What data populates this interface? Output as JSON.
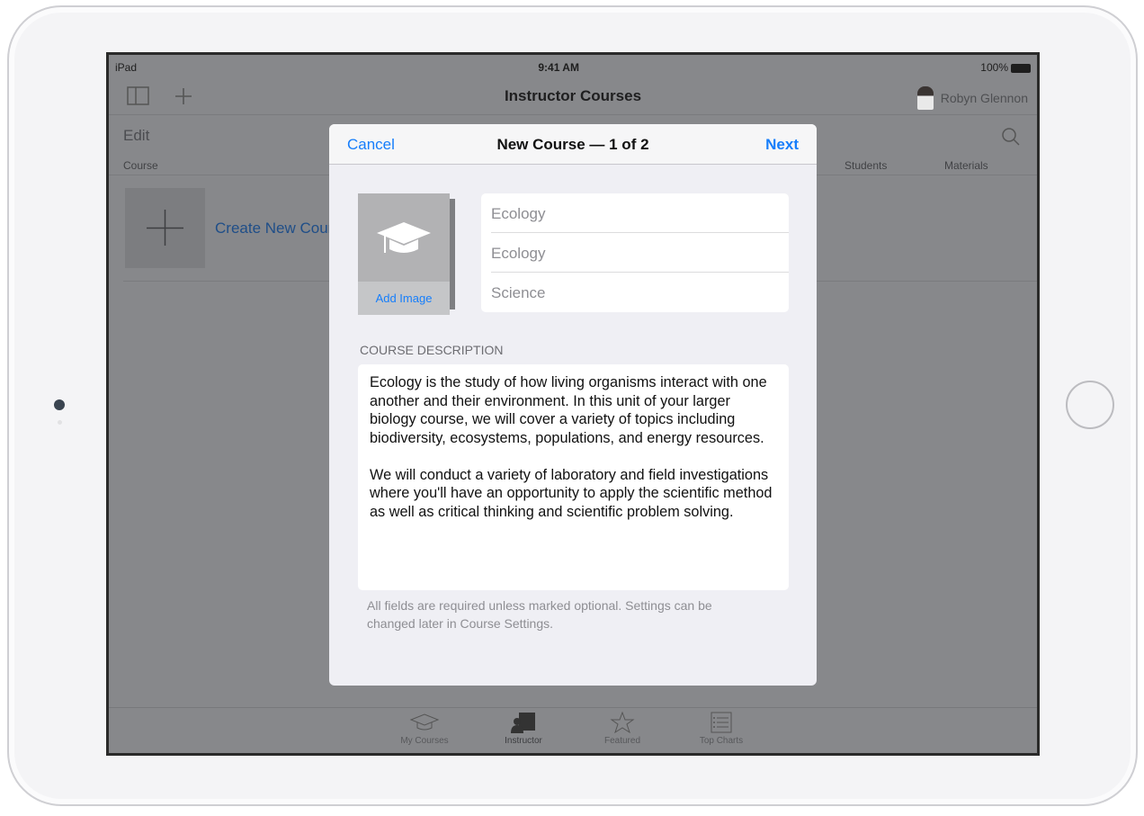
{
  "status": {
    "device": "iPad",
    "time": "9:41 AM",
    "battery": "100%"
  },
  "navbar": {
    "title": "Instructor Courses",
    "user": "Robyn Glennon"
  },
  "list": {
    "edit": "Edit",
    "col_course": "Course",
    "col_students": "Students",
    "col_materials": "Materials",
    "create": "Create New Course"
  },
  "tabs": [
    {
      "label": "My Courses",
      "icon": "graduation-cap-icon"
    },
    {
      "label": "Instructor",
      "icon": "instructor-icon"
    },
    {
      "label": "Featured",
      "icon": "star-icon"
    },
    {
      "label": "Top Charts",
      "icon": "list-icon"
    }
  ],
  "modal": {
    "cancel": "Cancel",
    "title": "New Course — 1 of 2",
    "next": "Next",
    "add_image": "Add Image",
    "fields": [
      "Ecology",
      "Ecology",
      "Science"
    ],
    "description_label": "COURSE DESCRIPTION",
    "description": [
      "Ecology is the study of how living organisms interact with one another and their environment. In this unit of your larger biology course, we will cover a variety of topics including biodiversity, ecosystems, populations, and energy resources.",
      "We will conduct a variety of laboratory and field investigations where you'll have an opportunity to apply the scientific method as well as critical thinking and scientific problem solving."
    ],
    "footer": "All fields are required unless marked optional. Settings can be changed later in Course Settings."
  },
  "colors": {
    "accent": "#167efb",
    "overlay": "#87888b"
  }
}
